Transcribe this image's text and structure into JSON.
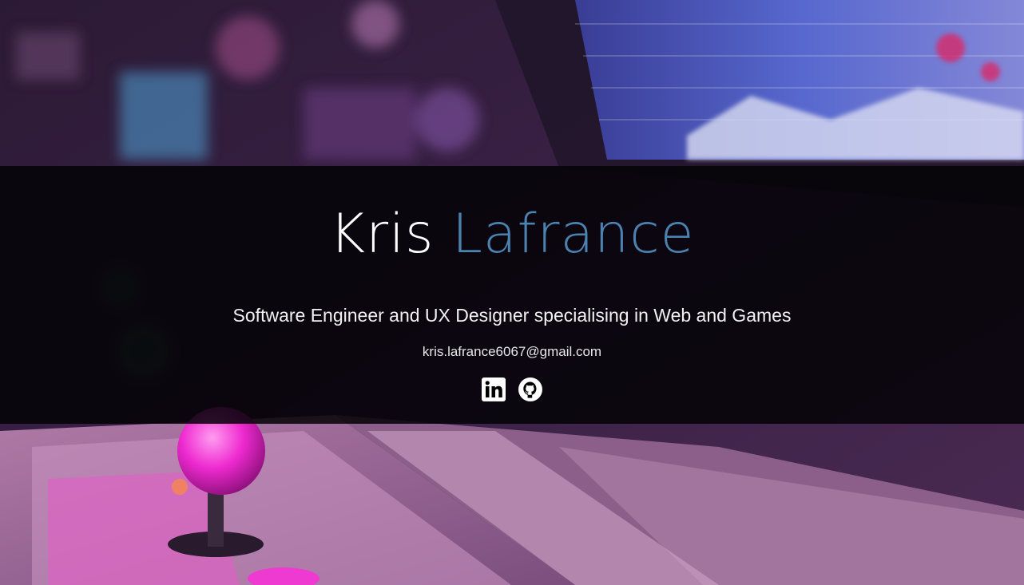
{
  "hero": {
    "first_name": "Kris",
    "last_name": "Lafrance",
    "tagline": "Software Engineer and UX Designer specialising in Web and Games",
    "email": "kris.lafrance6067@gmail.com",
    "socials": [
      {
        "icon": "linkedin-icon",
        "label": "LinkedIn"
      },
      {
        "icon": "github-icon",
        "label": "GitHub"
      }
    ]
  },
  "colors": {
    "accent": "#4b82b0",
    "banner": "#030206",
    "text": "#ffffff"
  }
}
